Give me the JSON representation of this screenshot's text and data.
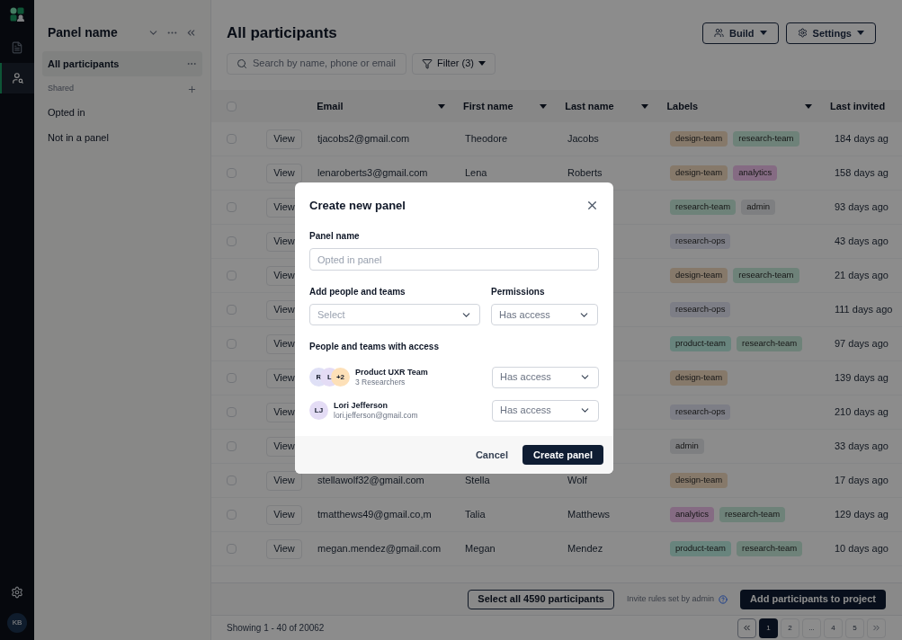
{
  "rail": {
    "avatar": "KB",
    "items": [
      {
        "kind": "document",
        "selected": false
      },
      {
        "kind": "people",
        "selected": true
      }
    ]
  },
  "sidebar": {
    "title": "Panel name",
    "items": [
      {
        "kind": "item",
        "label": "All participants",
        "selected": true
      },
      {
        "kind": "section",
        "label": "Shared"
      },
      {
        "kind": "item",
        "label": "Opted in",
        "selected": false
      },
      {
        "kind": "item",
        "label": "Not in a panel",
        "selected": false
      }
    ]
  },
  "header": {
    "title": "All participants",
    "buttons": [
      {
        "kind": "build",
        "label": "Build"
      },
      {
        "kind": "settings",
        "label": "Settings"
      }
    ],
    "search": {
      "placeholder": "Search by name, phone or email"
    },
    "filter": "Filter (3)"
  },
  "table": {
    "select_all_checked": false,
    "columns": [
      "Email",
      "First name",
      "Last name",
      "Labels",
      "Last invited"
    ],
    "rows": [
      {
        "checked": false,
        "view": "View",
        "email": "tjacobs2@gmail.com",
        "first": "Theodore",
        "last": "Jacobs",
        "labels": [
          {
            "text": "design-team",
            "color": "#86796a"
          },
          {
            "text": "research-team",
            "color": "#6e8279"
          }
        ],
        "invited": "184 days ag"
      },
      {
        "checked": false,
        "view": "View",
        "email": "lenaroberts3@gmail.com",
        "first": "Lena",
        "last": "Roberts",
        "labels": [
          {
            "text": "design-team",
            "color": "#86796a"
          },
          {
            "text": "analytics",
            "color": "#856b83"
          }
        ],
        "invited": "158 days ag"
      },
      {
        "checked": false,
        "view": "View",
        "labels": [
          {
            "text": "research-team",
            "color": "#6e8279"
          },
          {
            "text": "admin",
            "color": "#7e7f81"
          }
        ],
        "invited": "93 days ago"
      },
      {
        "checked": false,
        "view": "View",
        "labels": [
          {
            "text": "research-ops",
            "color": "#7d7e86"
          }
        ],
        "invited": "43 days ago"
      },
      {
        "checked": false,
        "view": "View",
        "labels": [
          {
            "text": "design-team",
            "color": "#86796a"
          },
          {
            "text": "research-team",
            "color": "#6e8279"
          }
        ],
        "invited": "21 days ago"
      },
      {
        "checked": false,
        "view": "View",
        "labels": [
          {
            "text": "research-ops",
            "color": "#7d7e86"
          }
        ],
        "invited": "111 days ago"
      },
      {
        "checked": false,
        "view": "View",
        "labels": [
          {
            "text": "product-team",
            "color": "#68847d"
          },
          {
            "text": "research-team",
            "color": "#6e8279"
          }
        ],
        "invited": "97 days ago"
      },
      {
        "checked": false,
        "view": "View",
        "labels": [
          {
            "text": "design-team",
            "color": "#86796a"
          }
        ],
        "invited": "139 days ag"
      },
      {
        "checked": false,
        "view": "View",
        "labels": [
          {
            "text": "research-ops",
            "color": "#7d7e86"
          }
        ],
        "invited": "210 days ag"
      },
      {
        "checked": false,
        "view": "View",
        "labels": [
          {
            "text": "admin",
            "color": "#7e7f81"
          }
        ],
        "invited": "33 days ago"
      },
      {
        "checked": false,
        "view": "View",
        "email": "stellawolf32@gmail.com",
        "first": "Stella",
        "last": "Wolf",
        "labels": [
          {
            "text": "design-team",
            "color": "#86796a"
          }
        ],
        "invited": "17 days ago"
      },
      {
        "checked": false,
        "view": "View",
        "email": "tmatthews49@gmail.co,m",
        "first": "Talia",
        "last": "Matthews",
        "labels": [
          {
            "text": "analytics",
            "color": "#856b83"
          },
          {
            "text": "research-team",
            "color": "#6e8279"
          }
        ],
        "invited": "129 days ag"
      },
      {
        "checked": false,
        "view": "View",
        "email": "megan.mendez@gmail.com",
        "first": "Megan",
        "last": "Mendez",
        "labels": [
          {
            "text": "product-team",
            "color": "#68847d"
          },
          {
            "text": "research-team",
            "color": "#6e8279"
          }
        ],
        "invited": "10 days ago"
      }
    ]
  },
  "action_bar": {
    "select_all": "Select all 4590 participants",
    "note": "Invite rules set by admin",
    "primary": "Add participants to project"
  },
  "footer": {
    "showing": "Showing 1 - 40 of 20062",
    "pages": [
      {
        "label": "1",
        "selected": true
      },
      {
        "label": "2",
        "selected": false
      },
      {
        "label": "...",
        "selected": false
      },
      {
        "label": "4",
        "selected": false
      },
      {
        "label": "5",
        "selected": false
      }
    ]
  },
  "dialog": {
    "title": "Create new panel",
    "name_label": "Panel name",
    "name_placeholder": "Opted in panel",
    "add_label": "Add people and teams",
    "add_placeholder": "Select",
    "perm_label": "Permissions",
    "perm_value": "Has access",
    "access_label": "People and teams with access",
    "access": [
      {
        "avatars": [
          {
            "text": "R",
            "color": "#dfe0f6"
          },
          {
            "text": "L",
            "color": "#e4dcf5"
          },
          {
            "text": "+2",
            "color": "#fde0b8"
          }
        ],
        "name": "Product UXR Team",
        "sub": "3 Researchers",
        "permission": "Has access"
      },
      {
        "avatars": [
          {
            "text": "LJ",
            "color": "#e4dcf5"
          }
        ],
        "name": "Lori Jefferson",
        "sub": "lori.jefferson@gmail.com",
        "permission": "Has access"
      }
    ],
    "cancel": "Cancel",
    "submit": "Create panel"
  }
}
